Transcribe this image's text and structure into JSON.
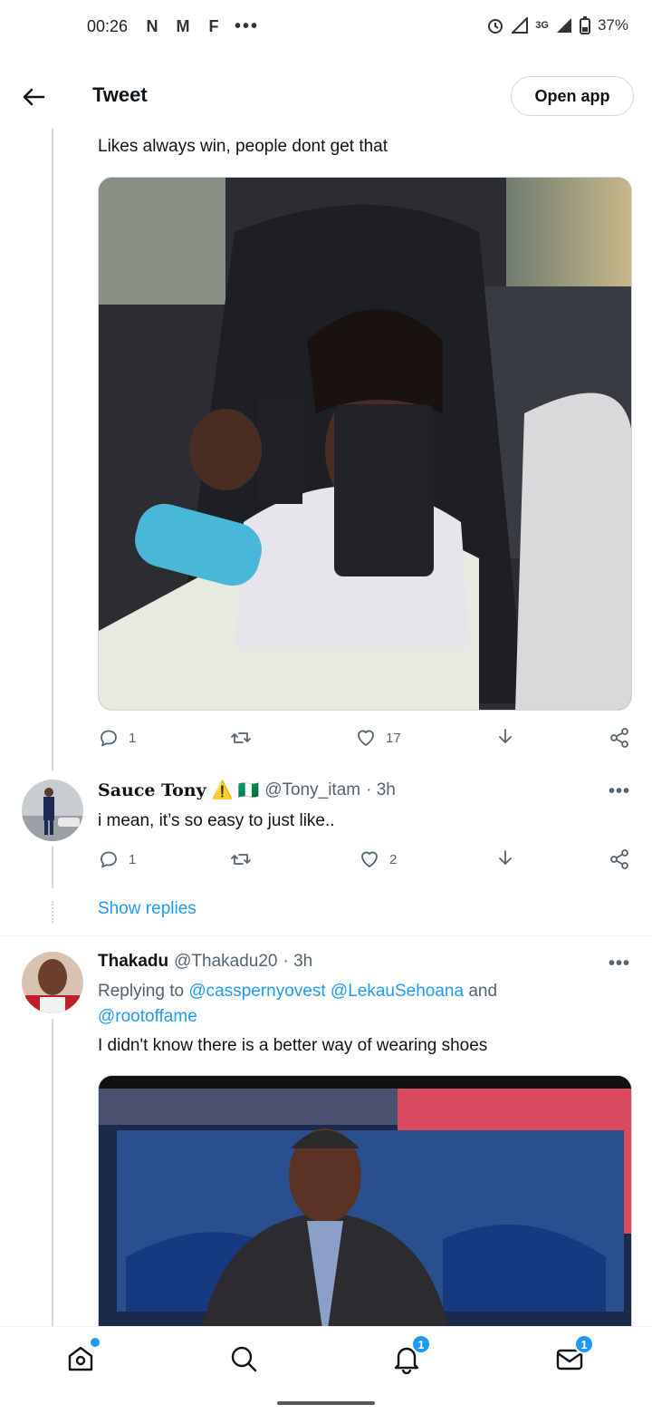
{
  "status_bar": {
    "time": "00:26",
    "notification_icons": [
      "N",
      "M",
      "F"
    ],
    "more": "•••",
    "network": "3G",
    "battery": "37%"
  },
  "header": {
    "title": "Tweet",
    "open_app": "Open app"
  },
  "tweet1": {
    "text": "Likes always win, people dont get that",
    "replies": "1",
    "retweets": "",
    "likes": "17"
  },
  "tweet2": {
    "name": "Sauce Tony",
    "badges": "⚠️ 🇳🇬",
    "handle": "@Tony_itam",
    "time": "· 3h",
    "text": "i mean, it’s so easy to just like..",
    "replies": "1",
    "retweets": "",
    "likes": "2",
    "more": "•••"
  },
  "show_replies": "Show replies",
  "tweet3": {
    "name": "Thakadu",
    "handle": "@Thakadu20",
    "time": "· 3h",
    "replying_prefix": "Replying to",
    "mention1": "@casspernyovest",
    "mention2": "@LekauSehoana",
    "and": "and",
    "mention3": "@rootoffame",
    "text": "I didn't know there is a better way of wearing shoes",
    "more": "•••"
  },
  "bottom_nav": {
    "notifications_badge": "1",
    "messages_badge": "1"
  },
  "colors": {
    "accent": "#1d9bf0",
    "text": "#0f1419",
    "muted": "#536471",
    "border": "#cfd9de"
  },
  "icons": [
    "back-arrow-icon",
    "reply-icon",
    "retweet-icon",
    "like-icon",
    "share-icon",
    "more-icon",
    "home-icon",
    "search-icon",
    "bell-icon",
    "mail-icon"
  ]
}
